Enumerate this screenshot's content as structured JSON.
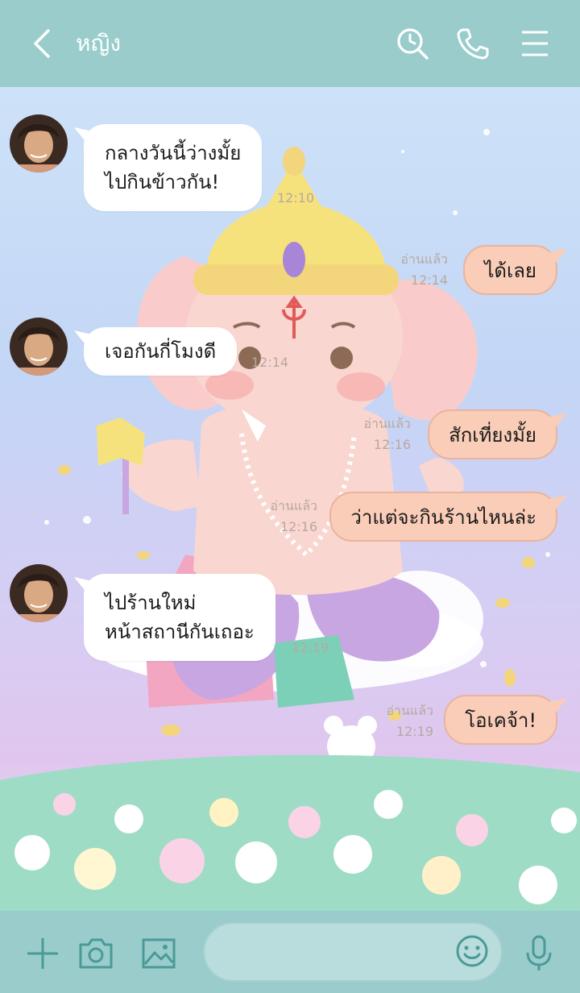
{
  "header": {
    "title": "หญิง",
    "icons": [
      "back-chevron-icon",
      "search-icon",
      "phone-icon",
      "menu-icon"
    ]
  },
  "messages": [
    {
      "side": "left",
      "lines": [
        "กลางวันนี้ว่างมั้ย",
        "ไปกินข้าวกัน!"
      ],
      "time": "12:10"
    },
    {
      "side": "right",
      "text": "ได้เลย",
      "read": "อ่านแล้ว",
      "time": "12:14"
    },
    {
      "side": "left",
      "lines": [
        "เจอกันกี่โมงดี"
      ],
      "time": "12:14"
    },
    {
      "side": "right",
      "text": "สักเที่ยงมั้ย",
      "read": "อ่านแล้ว",
      "time": "12:16"
    },
    {
      "side": "right",
      "text": "ว่าแต่จะกินร้านไหนล่ะ",
      "read": "อ่านแล้ว",
      "time": "12:16"
    },
    {
      "side": "left",
      "lines": [
        "ไปร้านใหม่",
        "หน้าสถานีกันเถอะ"
      ],
      "time": "12:19"
    },
    {
      "side": "right",
      "text": "โอเคจ้า!",
      "read": "อ่านแล้ว",
      "time": "12:19"
    }
  ],
  "footer": {
    "icons": [
      "plus-icon",
      "camera-icon",
      "image-icon",
      "emoji-icon",
      "microphone-icon"
    ],
    "input_value": ""
  },
  "colors": {
    "header_bg": "#99cccb",
    "outgoing_bubble": "#f9cdb8",
    "incoming_bubble": "#ffffff"
  }
}
